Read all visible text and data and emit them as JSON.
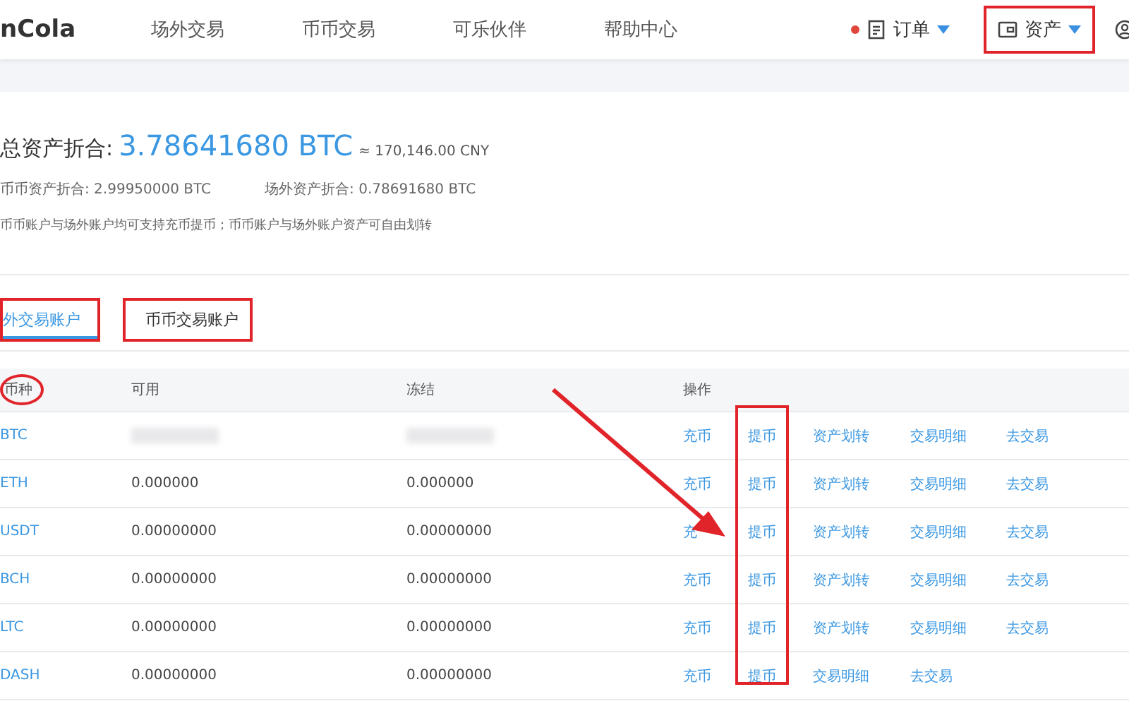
{
  "nav": {
    "logo": "nCola",
    "links": [
      {
        "label": "场外交易"
      },
      {
        "label": "币币交易"
      },
      {
        "label": "可乐伙伴"
      },
      {
        "label": "帮助中心"
      }
    ],
    "menus": [
      {
        "kind": "orders",
        "label": "订单",
        "notification": true,
        "highlighted": false
      },
      {
        "kind": "assets",
        "label": "资产",
        "notification": false,
        "highlighted": true
      }
    ]
  },
  "summary": {
    "label": "总资产折合:",
    "total": "3.78641680 BTC",
    "approx": "≈ 170,146.00 CNY",
    "spot": "币币资产折合: 2.99950000 BTC",
    "otc": "场外资产折合: 0.78691680 BTC",
    "note": "币币账户与场外账户均可支持充币提币；币币账户与场外账户资产可自由划转"
  },
  "tabs": [
    {
      "label": "外交易账户",
      "selected": true,
      "highlighted": true
    },
    {
      "label": "币币交易账户",
      "selected": false,
      "highlighted": true
    }
  ],
  "table": {
    "columns": [
      {
        "label": "币种",
        "circled": true
      },
      {
        "label": "可用",
        "circled": false
      },
      {
        "label": "冻结",
        "circled": false
      },
      {
        "label": "操作",
        "circled": false
      }
    ],
    "rows": [
      {
        "coin": "BTC",
        "masked": true,
        "actions": [
          "充币",
          "提币",
          "资产划转",
          "交易明细",
          "去交易"
        ]
      },
      {
        "coin": "ETH",
        "available": "0.000000",
        "frozen": "0.000000",
        "actions": [
          "充币",
          "提币",
          "资产划转",
          "交易明细",
          "去交易"
        ]
      },
      {
        "coin": "USDT",
        "available": "0.00000000",
        "frozen": "0.00000000",
        "actions": [
          "充",
          "提币",
          "资产划转",
          "交易明细",
          "去交易"
        ]
      },
      {
        "coin": "BCH",
        "available": "0.00000000",
        "frozen": "0.00000000",
        "actions": [
          "充币",
          "提币",
          "资产划转",
          "交易明细",
          "去交易"
        ]
      },
      {
        "coin": "LTC",
        "available": "0.00000000",
        "frozen": "0.00000000",
        "actions": [
          "充币",
          "提币",
          "资产划转",
          "交易明细",
          "去交易"
        ]
      },
      {
        "coin": "DASH",
        "available": "0.00000000",
        "frozen": "0.00000000",
        "actions": [
          "充币",
          "提币",
          "交易明细",
          "去交易"
        ]
      }
    ]
  },
  "annotations": {
    "arrow": true,
    "column_box": true
  }
}
